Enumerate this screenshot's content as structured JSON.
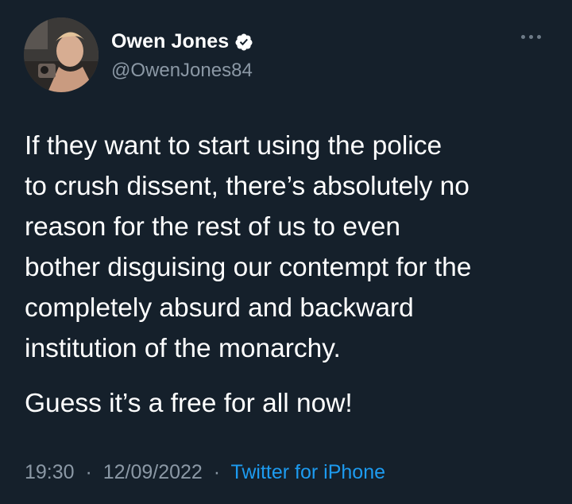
{
  "author": {
    "display_name": "Owen Jones",
    "handle": "@OwenJones84",
    "verified": true
  },
  "tweet": {
    "lines": [
      "If they want to start using the police",
      "to crush dissent, there’s absolutely no",
      "reason for the rest of us to even",
      "bother disguising our contempt for the",
      "completely absurd and backward",
      "institution of the monarchy."
    ],
    "second_paragraph": "Guess it’s a free for all now!"
  },
  "meta": {
    "time": "19:30",
    "separator": "·",
    "date": "12/09/2022",
    "source": "Twitter for iPhone"
  },
  "icons": {
    "verified": "verified-badge-icon",
    "more": "more-options-icon"
  },
  "colors": {
    "background": "#15202b",
    "secondary_text": "#8b98a5",
    "link": "#1d9bf0"
  }
}
